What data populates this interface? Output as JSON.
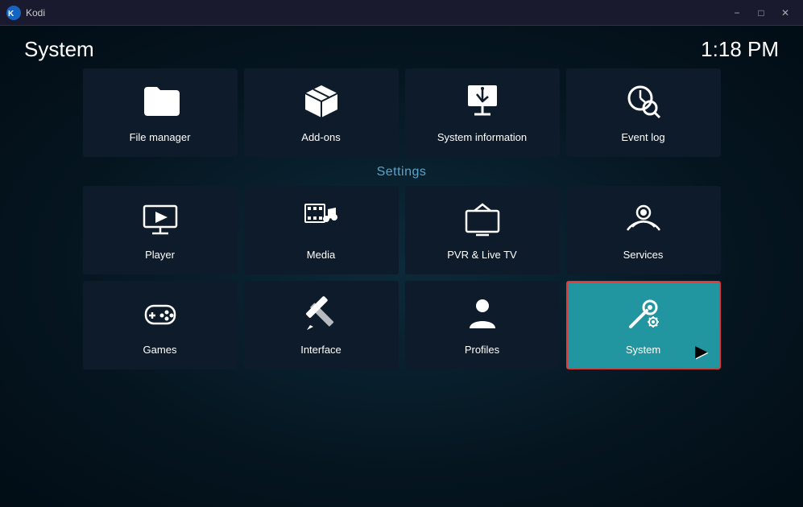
{
  "titlebar": {
    "app_name": "Kodi",
    "minimize_label": "−",
    "maximize_label": "□",
    "close_label": "✕"
  },
  "header": {
    "page_title": "System",
    "clock": "1:18 PM"
  },
  "top_row": {
    "items": [
      {
        "id": "file-manager",
        "label": "File manager",
        "icon": "folder"
      },
      {
        "id": "add-ons",
        "label": "Add-ons",
        "icon": "box"
      },
      {
        "id": "system-information",
        "label": "System information",
        "icon": "presentation"
      },
      {
        "id": "event-log",
        "label": "Event log",
        "icon": "clock-search"
      }
    ]
  },
  "settings_section": {
    "label": "Settings",
    "rows": [
      [
        {
          "id": "player",
          "label": "Player",
          "icon": "monitor-play"
        },
        {
          "id": "media",
          "label": "Media",
          "icon": "media"
        },
        {
          "id": "pvr-live-tv",
          "label": "PVR & Live TV",
          "icon": "tv"
        },
        {
          "id": "services",
          "label": "Services",
          "icon": "podcast"
        }
      ],
      [
        {
          "id": "games",
          "label": "Games",
          "icon": "gamepad"
        },
        {
          "id": "interface",
          "label": "Interface",
          "icon": "tools"
        },
        {
          "id": "profiles",
          "label": "Profiles",
          "icon": "person"
        },
        {
          "id": "system",
          "label": "System",
          "icon": "gear",
          "active": true
        }
      ]
    ]
  }
}
